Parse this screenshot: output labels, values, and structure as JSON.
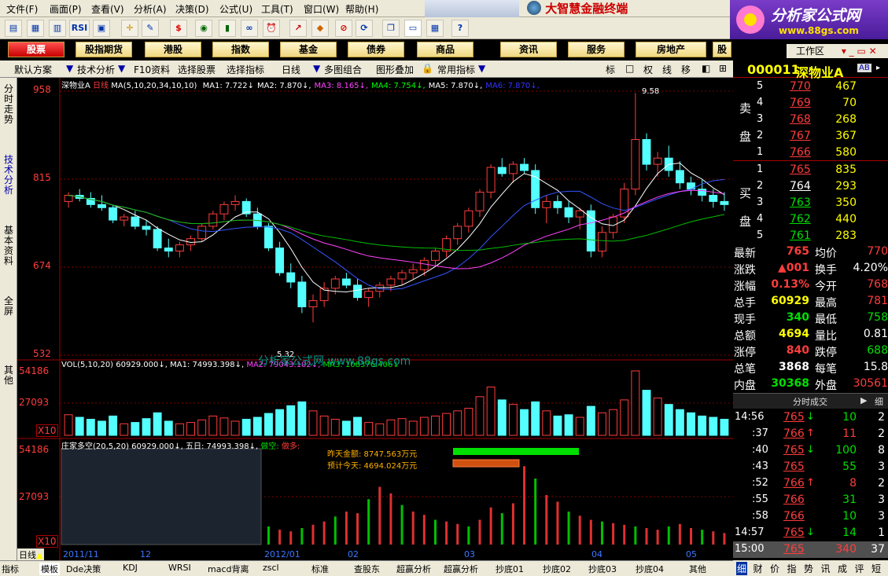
{
  "menu": [
    "文件(F)",
    "画面(P)",
    "查看(V)",
    "分析(A)",
    "决策(D)",
    "公式(U)",
    "工具(T)",
    "窗口(W)",
    "帮助(H)"
  ],
  "brand_title": "大智慧金融终端",
  "logo": {
    "name": "分析家公式网",
    "url": "www.88gs.com"
  },
  "toolbar_icons": [
    "open-icon",
    "chart-icon",
    "kline-icon",
    "rsi-icon",
    "order-icon",
    "crosshair-icon",
    "ruler-icon",
    "dollar-icon",
    "eye-icon",
    "bars-icon",
    "binoculars-icon",
    "alarm-icon",
    "arrow-icon",
    "diamond-icon",
    "search-icon",
    "refresh-icon",
    "copy-icon",
    "layout-icon",
    "grid-icon",
    "help-icon"
  ],
  "toolbar_labels": {
    "rsi": "RSI"
  },
  "nav": [
    "股票",
    "股指期货",
    "港股",
    "指数",
    "基金",
    "债券",
    "商品",
    "资讯",
    "服务",
    "房地产",
    "股票"
  ],
  "workspace_label": "工作区",
  "subbar": [
    "默认方案",
    "技术分析",
    "F10资料",
    "选择股票",
    "选择指标",
    "日线",
    "多图组合",
    "图形叠加",
    "常用指标"
  ],
  "mode_buttons": [
    "标",
    "□",
    "权",
    "线",
    "移",
    "◧",
    "⊞"
  ],
  "left_tabs": [
    "分时走势",
    "技术分析",
    "基本资料",
    "全屏",
    "其他"
  ],
  "chart": {
    "stock_name": "深物业A",
    "period": "日线",
    "ma_label": "MA(5,10,20,34,10,10)",
    "ma_values": [
      {
        "label": "MA1: 7.722",
        "color": "#ffffff"
      },
      {
        "label": "MA2: 7.870",
        "color": "#ffffff"
      },
      {
        "label": "MA3: 8.165",
        "color": "#ff44ff"
      },
      {
        "label": "MA4: 7.754",
        "color": "#00ff00"
      },
      {
        "label": "MA5: 7.870",
        "color": "#ffffff"
      },
      {
        "label": "MA6: 7.870",
        "color": "#3333ff"
      }
    ],
    "price_axis": [
      "958",
      "815",
      "674",
      "532"
    ],
    "high_marker": "9.58",
    "low_marker": "5.32",
    "vol_label": "VOL(5,10,20)",
    "vol_values": [
      "60929.000",
      "MA1: 74993.398",
      "MA2: 79043.102",
      "MA3: 108376.406"
    ],
    "vol_axis": [
      "54186",
      "27093",
      "X10"
    ],
    "zj_label": "庄家多空(20,5,20)",
    "zj_values": [
      "60929.000",
      "五日: 74993.398",
      "做空:",
      "做多:"
    ],
    "zj_axis": [
      "54186",
      "27093",
      "X10"
    ],
    "yesterday": "昨天金额: 8747.563万元",
    "today_est": "预计今天: 4694.024万元",
    "watermark": "分析家公式网 www.88gs.com",
    "date_axis": [
      "2011/11",
      "12",
      "2012/01",
      "02",
      "03",
      "04",
      "05"
    ],
    "period_btn": "日线"
  },
  "quote": {
    "code": "000011",
    "name": "深物业A",
    "ab": "AB",
    "sell": [
      {
        "level": "5",
        "price": "770",
        "vol": "467"
      },
      {
        "level": "4",
        "price": "769",
        "vol": "70"
      },
      {
        "level": "3",
        "price": "768",
        "vol": "268"
      },
      {
        "level": "2",
        "price": "767",
        "vol": "367"
      },
      {
        "level": "1",
        "price": "766",
        "vol": "580"
      }
    ],
    "buy": [
      {
        "level": "1",
        "price": "765",
        "vol": "835"
      },
      {
        "level": "2",
        "price": "764",
        "vol": "293"
      },
      {
        "level": "3",
        "price": "763",
        "vol": "350"
      },
      {
        "level": "4",
        "price": "762",
        "vol": "440"
      },
      {
        "level": "5",
        "price": "761",
        "vol": "283"
      }
    ],
    "sell_label": [
      "卖",
      "盘"
    ],
    "buy_label": [
      "买",
      "盘"
    ],
    "stats": [
      {
        "k1": "最新",
        "v1": "765",
        "k2": "均价",
        "v2": "770"
      },
      {
        "k1": "涨跌",
        "v1": "▲001",
        "k2": "换手",
        "v2": "4.20%"
      },
      {
        "k1": "涨幅",
        "v1": "0.13%",
        "k2": "今开",
        "v2": "768"
      },
      {
        "k1": "总手",
        "v1": "60929",
        "k2": "最高",
        "v2": "781"
      },
      {
        "k1": "现手",
        "v1": "340",
        "k2": "最低",
        "v2": "758"
      },
      {
        "k1": "总额",
        "v1": "4694",
        "k2": "量比",
        "v2": "0.81"
      },
      {
        "k1": "涨停",
        "v1": "840",
        "k2": "跌停",
        "v2": "688"
      },
      {
        "k1": "总笔",
        "v1": "3868",
        "k2": "每笔",
        "v2": "15.8"
      },
      {
        "k1": "内盘",
        "v1": "30368",
        "k2": "外盘",
        "v2": "30561"
      }
    ],
    "ticks_title": "分时成交",
    "ticks_more": "细",
    "ticks": [
      {
        "t": "14:56",
        "p": "765",
        "a": "↓",
        "v": "10",
        "n": "2"
      },
      {
        "t": ":37",
        "p": "766",
        "a": "↑",
        "v": "11",
        "n": "2"
      },
      {
        "t": ":40",
        "p": "765",
        "a": "↓",
        "v": "100",
        "n": "8"
      },
      {
        "t": ":43",
        "p": "765",
        "a": "",
        "v": "55",
        "n": "3"
      },
      {
        "t": ":52",
        "p": "766",
        "a": "↑",
        "v": "8",
        "n": "2"
      },
      {
        "t": ":55",
        "p": "766",
        "a": "",
        "v": "31",
        "n": "3"
      },
      {
        "t": ":58",
        "p": "766",
        "a": "",
        "v": "10",
        "n": "3"
      },
      {
        "t": "14:57",
        "p": "765",
        "a": "↓",
        "v": "14",
        "n": "1"
      },
      {
        "t": "15:00",
        "p": "765",
        "a": "",
        "v": "340",
        "n": "37"
      }
    ],
    "bottom_tabs": [
      "细",
      "财",
      "价",
      "指",
      "势",
      "讯",
      "成",
      "评",
      "短"
    ]
  },
  "bottom_tabs": [
    "指标",
    "模板",
    "Dde决策",
    "KDJ",
    "WRSI",
    "macd背离",
    "zscl",
    "标准",
    "查股东",
    "超赢分析",
    "超赢分析",
    "抄底01",
    "抄底02",
    "抄底03",
    "抄底04",
    "其他"
  ],
  "candles": [
    [
      780,
      795,
      770,
      790
    ],
    [
      790,
      800,
      780,
      785
    ],
    [
      785,
      795,
      770,
      775
    ],
    [
      775,
      790,
      765,
      770
    ],
    [
      770,
      775,
      745,
      750
    ],
    [
      750,
      760,
      740,
      755
    ],
    [
      755,
      765,
      735,
      740
    ],
    [
      740,
      750,
      725,
      735
    ],
    [
      735,
      740,
      700,
      705
    ],
    [
      705,
      720,
      690,
      700
    ],
    [
      700,
      715,
      690,
      710
    ],
    [
      710,
      725,
      700,
      720
    ],
    [
      720,
      745,
      715,
      740
    ],
    [
      740,
      765,
      735,
      760
    ],
    [
      760,
      780,
      750,
      775
    ],
    [
      775,
      790,
      765,
      780
    ],
    [
      780,
      785,
      755,
      760
    ],
    [
      760,
      770,
      735,
      740
    ],
    [
      740,
      745,
      700,
      705
    ],
    [
      705,
      715,
      660,
      665
    ],
    [
      665,
      680,
      640,
      650
    ],
    [
      650,
      660,
      600,
      610
    ],
    [
      610,
      630,
      585,
      620
    ],
    [
      620,
      650,
      610,
      640
    ],
    [
      640,
      660,
      630,
      655
    ],
    [
      655,
      665,
      640,
      645
    ],
    [
      645,
      655,
      620,
      625
    ],
    [
      625,
      640,
      610,
      635
    ],
    [
      635,
      650,
      625,
      645
    ],
    [
      645,
      660,
      635,
      655
    ],
    [
      655,
      670,
      645,
      665
    ],
    [
      665,
      680,
      655,
      670
    ],
    [
      670,
      690,
      660,
      685
    ],
    [
      685,
      705,
      675,
      700
    ],
    [
      700,
      725,
      690,
      720
    ],
    [
      720,
      745,
      710,
      740
    ],
    [
      740,
      770,
      730,
      765
    ],
    [
      765,
      800,
      755,
      795
    ],
    [
      795,
      840,
      785,
      835
    ],
    [
      835,
      850,
      820,
      825
    ],
    [
      825,
      845,
      810,
      840
    ],
    [
      840,
      850,
      825,
      830
    ],
    [
      830,
      840,
      760,
      770
    ],
    [
      770,
      790,
      745,
      780
    ],
    [
      780,
      790,
      760,
      770
    ],
    [
      770,
      780,
      745,
      755
    ],
    [
      755,
      770,
      735,
      765
    ],
    [
      765,
      775,
      690,
      700
    ],
    [
      700,
      740,
      690,
      730
    ],
    [
      730,
      760,
      720,
      755
    ],
    [
      755,
      810,
      745,
      800
    ],
    [
      800,
      955,
      790,
      880
    ],
    [
      880,
      890,
      830,
      840
    ],
    [
      840,
      860,
      820,
      850
    ],
    [
      850,
      870,
      820,
      830
    ],
    [
      830,
      845,
      800,
      810
    ],
    [
      810,
      820,
      790,
      800
    ],
    [
      800,
      815,
      780,
      790
    ],
    [
      790,
      800,
      770,
      780
    ],
    [
      780,
      795,
      765,
      775
    ]
  ],
  "volumes": [
    32,
    28,
    25,
    22,
    30,
    18,
    20,
    26,
    35,
    22,
    18,
    20,
    24,
    30,
    27,
    22,
    25,
    28,
    34,
    40,
    46,
    52,
    38,
    30,
    25,
    22,
    28,
    20,
    18,
    24,
    26,
    22,
    28,
    30,
    34,
    38,
    42,
    60,
    75,
    55,
    48,
    40,
    52,
    38,
    30,
    32,
    28,
    45,
    35,
    40,
    55,
    100,
    70,
    58,
    48,
    40,
    35,
    30,
    28,
    25
  ],
  "zj_bars": [
    10,
    8,
    12,
    9,
    14,
    11,
    16,
    13,
    10,
    18,
    22,
    15,
    12,
    14,
    18,
    20,
    25,
    30,
    22,
    18,
    16,
    20,
    24,
    28,
    34,
    40,
    38,
    55,
    70,
    62,
    48,
    40,
    36,
    30,
    28,
    25,
    22,
    30,
    45,
    38,
    50,
    95,
    80,
    60,
    52,
    40,
    35,
    30,
    28,
    26,
    24,
    22,
    20,
    18,
    22,
    25,
    20,
    18,
    16,
    14
  ]
}
